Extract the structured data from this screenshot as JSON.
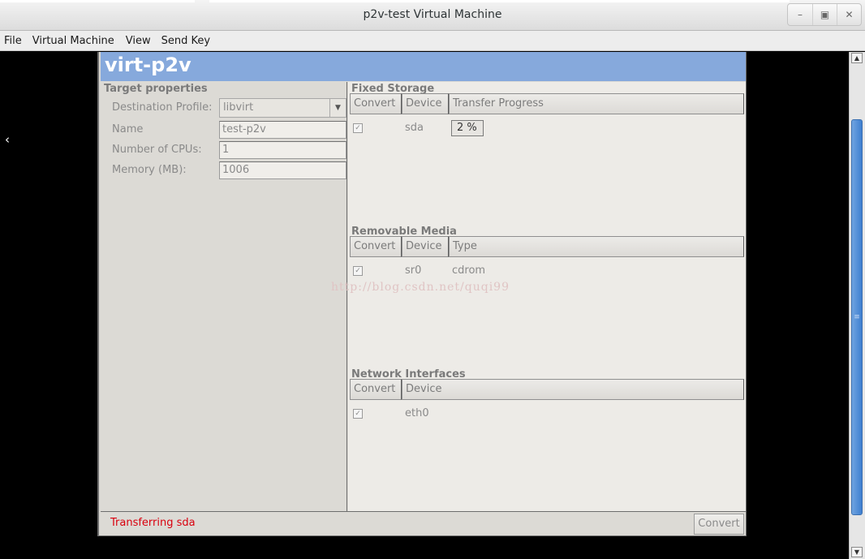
{
  "window": {
    "title": "p2v-test Virtual Machine"
  },
  "menu": [
    "File",
    "Virtual Machine",
    "View",
    "Send Key"
  ],
  "guest": {
    "banner_title": "virt-p2v",
    "target": {
      "heading": "Target properties",
      "profile_label": "Destination Profile:",
      "profile_value": "libvirt",
      "name_label": "Name",
      "name_value": "test-p2v",
      "cpus_label": "Number of CPUs:",
      "cpus_value": "1",
      "memory_label": "Memory (MB):",
      "memory_value": "1006"
    },
    "fixed_storage": {
      "heading": "Fixed Storage",
      "columns": [
        "Convert",
        "Device",
        "Transfer Progress"
      ],
      "rows": [
        {
          "checked": true,
          "device": "sda",
          "progress": "2 %"
        }
      ]
    },
    "removable_media": {
      "heading": "Removable Media",
      "columns": [
        "Convert",
        "Device",
        "Type"
      ],
      "rows": [
        {
          "checked": true,
          "device": "sr0",
          "type": "cdrom"
        }
      ]
    },
    "network": {
      "heading": "Network Interfaces",
      "columns": [
        "Convert",
        "Device"
      ],
      "rows": [
        {
          "checked": true,
          "device": "eth0"
        }
      ]
    },
    "status": "Transferring sda",
    "convert_button": "Convert"
  },
  "watermark": "http://blog.csdn.net/quqi99",
  "colors": {
    "banner": "#86a9dc",
    "status_text": "#d9000e",
    "scroll_thumb": "#3f7fd0"
  },
  "icons": {
    "minimize": "minimize-icon",
    "maximize": "maximize-icon",
    "close": "close-icon"
  }
}
